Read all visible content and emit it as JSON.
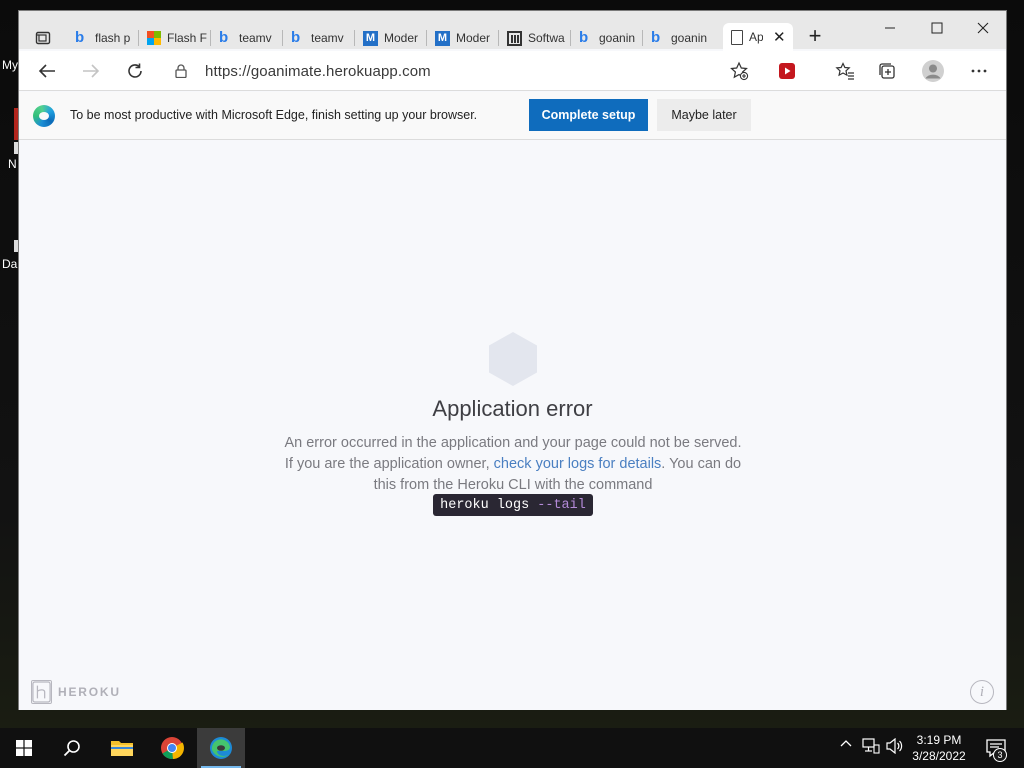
{
  "desktop": {
    "labels": [
      "My",
      "N",
      "Da"
    ]
  },
  "browser": {
    "tabs": [
      {
        "label": "flash p",
        "icon": "bing-icon"
      },
      {
        "label": "Flash F",
        "icon": "microsoft-icon"
      },
      {
        "label": "teamv",
        "icon": "bing-icon"
      },
      {
        "label": "teamv",
        "icon": "bing-icon"
      },
      {
        "label": "Moder",
        "icon": "m-icon"
      },
      {
        "label": "Moder",
        "icon": "m-icon"
      },
      {
        "label": "Softwa",
        "icon": "software-icon"
      },
      {
        "label": "goanin",
        "icon": "bing-icon"
      },
      {
        "label": "goanin",
        "icon": "bing-icon"
      },
      {
        "label": "Ap",
        "icon": "document-icon",
        "active": true
      }
    ],
    "url": "https://goanimate.herokuapp.com",
    "infobar": {
      "message": "To be most productive with Microsoft Edge, finish setting up your browser.",
      "primary_label": "Complete setup",
      "secondary_label": "Maybe later"
    }
  },
  "page": {
    "title": "Application error",
    "text_before_link": "An error occurred in the application and your page could not be served. If you are the application owner, ",
    "link_text": "check your logs for details",
    "text_after_link": ". You can do this from the Heroku CLI with the command",
    "command": "heroku logs",
    "command_flag": "--tail",
    "brand": "HEROKU",
    "info_symbol": "i"
  },
  "taskbar": {
    "time": "3:19 PM",
    "date": "3/28/2022",
    "notification_count": "3"
  },
  "colors": {
    "accent": "#0f6cbd",
    "link": "#4a7fc1",
    "command_bg": "#2a2733",
    "command_flag": "#b48ad8"
  }
}
